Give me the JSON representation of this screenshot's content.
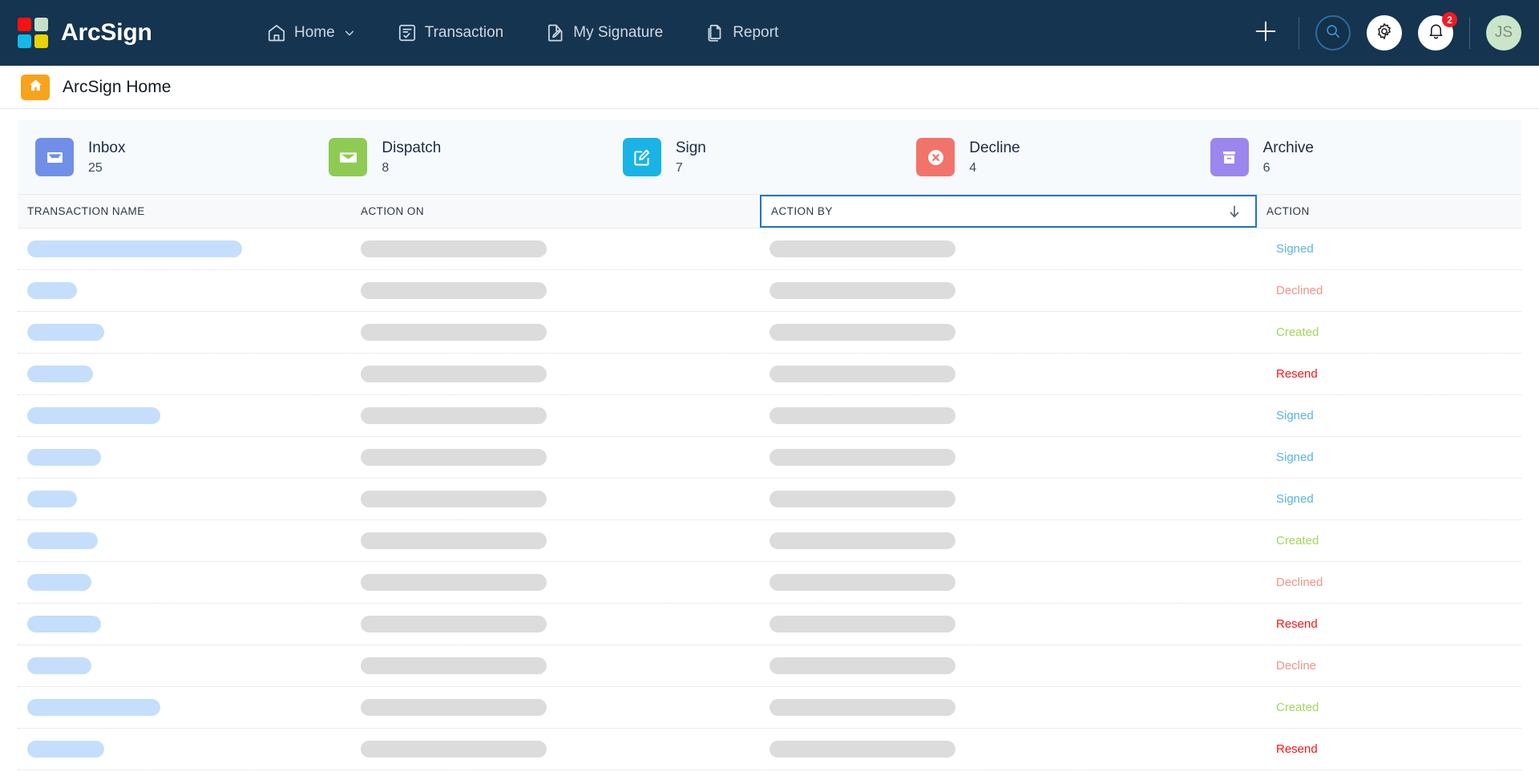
{
  "brand": {
    "name": "ArcSign",
    "logo_colors": [
      "#f61212",
      "#c8e0c8",
      "#14b9e8",
      "#e8d200"
    ]
  },
  "nav": {
    "items": [
      {
        "label": "Home",
        "icon": "home-icon",
        "has_chevron": true
      },
      {
        "label": "Transaction",
        "icon": "transaction-icon",
        "has_chevron": false
      },
      {
        "label": "My Signature",
        "icon": "signature-icon",
        "has_chevron": false
      },
      {
        "label": "Report",
        "icon": "report-icon",
        "has_chevron": false
      }
    ],
    "right": {
      "add_icon": "plus-icon",
      "search_icon": "search-icon",
      "settings_icon": "gear-icon",
      "notifications_icon": "bell-icon",
      "notification_count": "2",
      "avatar_initials": "JS",
      "badge_color": "#ef1b24",
      "avatar_color": "#cbe5c9"
    }
  },
  "titlebar": {
    "home_icon": "home-icon",
    "title": "ArcSign Home",
    "chip_color": "#f7a31b"
  },
  "cards": [
    {
      "label": "Inbox",
      "count": "25",
      "icon": "inbox-tray-icon",
      "color": "#6f8fe8"
    },
    {
      "label": "Dispatch",
      "count": "8",
      "icon": "envelope-icon",
      "color": "#8ecb53"
    },
    {
      "label": "Sign",
      "count": "7",
      "icon": "sign-pencil-icon",
      "color": "#19b4e5"
    },
    {
      "label": "Decline",
      "count": "4",
      "icon": "x-circle-icon",
      "color": "#f2736a"
    },
    {
      "label": "Archive",
      "count": "6",
      "icon": "archive-box-icon",
      "color": "#9b86ee"
    }
  ],
  "table": {
    "columns": [
      {
        "key": "transaction_name",
        "label": "TRANSACTION NAME",
        "sorted": false
      },
      {
        "key": "action_on",
        "label": "ACTION ON",
        "sorted": false
      },
      {
        "key": "action_by",
        "label": "ACTION BY",
        "sorted": true,
        "sort_direction": "desc",
        "focused": true
      },
      {
        "key": "action",
        "label": "ACTION",
        "sorted": false
      }
    ],
    "loading": true,
    "status_colors": {
      "Signed": "#5bb3e0",
      "Declined": "#f29288",
      "Decline": "#f29288",
      "Created": "#a3d65c",
      "Resend": "#fa1414"
    },
    "rows": [
      {
        "name_width": 268,
        "status": "Signed"
      },
      {
        "name_width": 62,
        "status": "Declined"
      },
      {
        "name_width": 96,
        "status": "Created"
      },
      {
        "name_width": 82,
        "status": "Resend"
      },
      {
        "name_width": 166,
        "status": "Signed"
      },
      {
        "name_width": 92,
        "status": "Signed"
      },
      {
        "name_width": 62,
        "status": "Signed"
      },
      {
        "name_width": 88,
        "status": "Created"
      },
      {
        "name_width": 80,
        "status": "Declined"
      },
      {
        "name_width": 92,
        "status": "Resend"
      },
      {
        "name_width": 80,
        "status": "Decline"
      },
      {
        "name_width": 166,
        "status": "Created"
      },
      {
        "name_width": 96,
        "status": "Resend"
      }
    ]
  }
}
